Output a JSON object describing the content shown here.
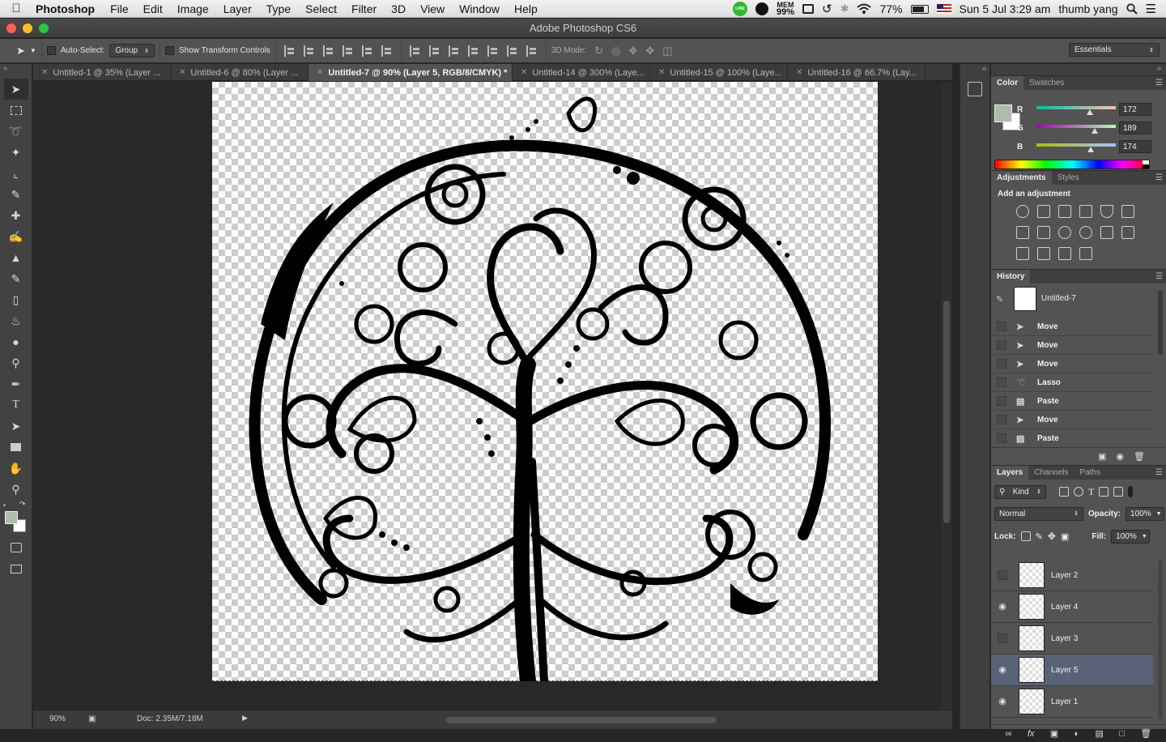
{
  "menubar": {
    "app": "Photoshop",
    "items": [
      "File",
      "Edit",
      "Image",
      "Layer",
      "Type",
      "Select",
      "Filter",
      "3D",
      "View",
      "Window",
      "Help"
    ],
    "status": {
      "line_badge": "LINE",
      "mem_label": "MEM",
      "mem_value": "99%",
      "battery": "77%",
      "datetime": "Sun 5 Jul  3:29 am",
      "user": "thumb yang"
    }
  },
  "window": {
    "title": "Adobe Photoshop CS6"
  },
  "options": {
    "auto_select_label": "Auto-Select:",
    "auto_select_value": "Group",
    "transform_label": "Show Transform Controls",
    "mode3d_label": "3D Mode:",
    "workspace": "Essentials"
  },
  "tabs": [
    {
      "label": "Untitled-1 @ 35% (Layer ..."
    },
    {
      "label": "Untitled-6 @ 80% (Layer ..."
    },
    {
      "label": "Untitled-7 @ 90% (Layer 5, RGB/8/CMYK) *"
    },
    {
      "label": "Untitled-14 @ 300% (Laye..."
    },
    {
      "label": "Untitled-15 @ 100% (Laye..."
    },
    {
      "label": "Untitled-16 @ 66.7% (Lay..."
    }
  ],
  "status": {
    "zoom": "90%",
    "doc": "Doc: 2.35M/7.18M"
  },
  "color_panel": {
    "tabs": [
      "Color",
      "Swatches"
    ],
    "foreground": "#acbdae",
    "r_label": "R",
    "r": "172",
    "g_label": "G",
    "g": "189",
    "b_label": "B",
    "b": "174"
  },
  "adjustments": {
    "tabs": [
      "Adjustments",
      "Styles"
    ],
    "title": "Add an adjustment"
  },
  "history": {
    "tab": "History",
    "snapshot": "Untitled-7",
    "items": [
      {
        "label": "Move",
        "icon": "move-icon"
      },
      {
        "label": "Move",
        "icon": "move-icon"
      },
      {
        "label": "Move",
        "icon": "move-icon"
      },
      {
        "label": "Lasso",
        "icon": "lasso-icon"
      },
      {
        "label": "Paste",
        "icon": "paste-icon"
      },
      {
        "label": "Move",
        "icon": "move-icon"
      },
      {
        "label": "Paste",
        "icon": "paste-icon"
      }
    ]
  },
  "layers_panel": {
    "tabs": [
      "Layers",
      "Channels",
      "Paths"
    ],
    "kind": "Kind",
    "blend": "Normal",
    "opacity_label": "Opacity:",
    "opacity": "100%",
    "lock_label": "Lock:",
    "fill_label": "Fill:",
    "fill": "100%",
    "layers": [
      {
        "name": "Layer 2",
        "visible": false,
        "selected": false
      },
      {
        "name": "Layer 4",
        "visible": true,
        "selected": false
      },
      {
        "name": "Layer 3",
        "visible": false,
        "selected": false
      },
      {
        "name": "Layer 5",
        "visible": true,
        "selected": true
      },
      {
        "name": "Layer 1",
        "visible": true,
        "selected": false
      }
    ]
  }
}
